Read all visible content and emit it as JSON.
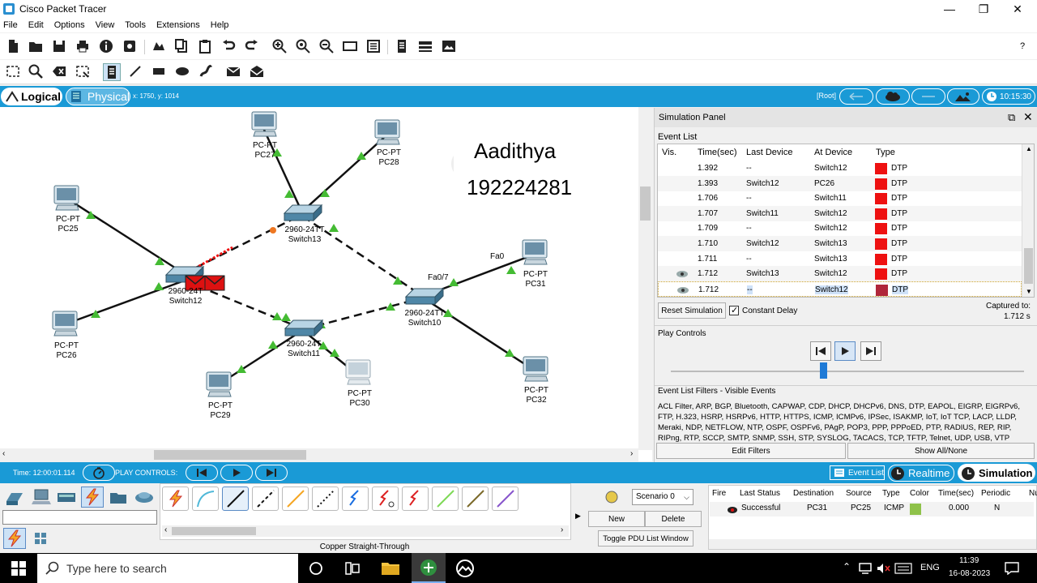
{
  "window": {
    "title": "Cisco Packet Tracer",
    "minimize": "—",
    "maximize": "❐",
    "close": "✕"
  },
  "menu": [
    "File",
    "Edit",
    "Options",
    "View",
    "Tools",
    "Extensions",
    "Help"
  ],
  "help_glyph": "?",
  "modebar": {
    "logical": "Logical",
    "physical": "Physical",
    "coords": "x: 1750, y: 1014",
    "root": "[Root]",
    "clock": "10:15:30"
  },
  "canvas": {
    "note_name": "Aadithya",
    "note_id": "192224281",
    "nodes": [
      {
        "id": "pc27",
        "type": "PC-PT",
        "name": "PC27"
      },
      {
        "id": "pc28",
        "type": "PC-PT",
        "name": "PC28"
      },
      {
        "id": "pc25",
        "type": "PC-PT",
        "name": "PC25"
      },
      {
        "id": "sw13",
        "type": "2960-24TT",
        "name": "Switch13"
      },
      {
        "id": "sw12",
        "type": "2960-24T",
        "name": "Switch12"
      },
      {
        "id": "pc31",
        "type": "PC-PT",
        "name": "PC31"
      },
      {
        "id": "sw10",
        "type": "2960-24TT",
        "name": "Switch10"
      },
      {
        "id": "pc26",
        "type": "PC-PT",
        "name": "PC26"
      },
      {
        "id": "sw11",
        "type": "2960-24T",
        "name": "Switch11"
      },
      {
        "id": "pc30",
        "type": "PC-PT",
        "name": "PC30"
      },
      {
        "id": "pc29",
        "type": "PC-PT",
        "name": "PC29"
      },
      {
        "id": "pc32",
        "type": "PC-PT",
        "name": "PC32"
      }
    ],
    "port_labels": {
      "fa0": "Fa0",
      "fa07": "Fa0/7"
    }
  },
  "sim_panel": {
    "title": "Simulation Panel",
    "event_list_label": "Event List",
    "columns": [
      "Vis.",
      "Time(sec)",
      "Last Device",
      "At Device",
      "Type"
    ],
    "events": [
      {
        "time": "1.392",
        "last": "--",
        "at": "Switch12",
        "type": "DTP",
        "eye": false
      },
      {
        "time": "1.393",
        "last": "Switch12",
        "at": "PC26",
        "type": "DTP",
        "eye": false
      },
      {
        "time": "1.706",
        "last": "--",
        "at": "Switch11",
        "type": "DTP",
        "eye": false
      },
      {
        "time": "1.707",
        "last": "Switch11",
        "at": "Switch12",
        "type": "DTP",
        "eye": false
      },
      {
        "time": "1.709",
        "last": "--",
        "at": "Switch12",
        "type": "DTP",
        "eye": false
      },
      {
        "time": "1.710",
        "last": "Switch12",
        "at": "Switch13",
        "type": "DTP",
        "eye": false
      },
      {
        "time": "1.711",
        "last": "--",
        "at": "Switch13",
        "type": "DTP",
        "eye": false
      },
      {
        "time": "1.712",
        "last": "Switch13",
        "at": "Switch12",
        "type": "DTP",
        "eye": true
      },
      {
        "time": "1.712",
        "last": "--",
        "at": "Switch12",
        "type": "DTP",
        "eye": true
      }
    ],
    "reset_label": "Reset Simulation",
    "constant_delay_label": "Constant Delay",
    "captured_label": "Captured to:",
    "captured_value": "1.712 s",
    "play_controls_label": "Play Controls",
    "filters_title": "Event List Filters - Visible Events",
    "filters_text": "ACL Filter, ARP, BGP, Bluetooth, CAPWAP, CDP, DHCP, DHCPv6, DNS, DTP, EAPOL, EIGRP, EIGRPv6, FTP, H.323, HSRP, HSRPv6, HTTP, HTTPS, ICMP, ICMPv6, IPSec, ISAKMP, IoT, IoT TCP, LACP, LLDP, Meraki, NDP, NETFLOW, NTP, OSPF, OSPFv6, PAgP, POP3, PPP, PPPoED, PTP, RADIUS, REP, RIP, RIPng, RTP, SCCP, SMTP, SNMP, SSH, STP, SYSLOG, TACACS, TCP, TFTP, Telnet, UDP, USB, VTP",
    "edit_filters": "Edit Filters",
    "show_all": "Show All/None"
  },
  "bottombar": {
    "time": "Time: 12:00:01.114",
    "play_controls": "PLAY CONTROLS:",
    "event_list": "Event List",
    "realtime": "Realtime",
    "simulation": "Simulation"
  },
  "devices": {
    "cable_label": "Copper Straight-Through"
  },
  "pdu": {
    "scenario": "Scenario 0",
    "new": "New",
    "delete": "Delete",
    "toggle": "Toggle PDU List Window",
    "columns": [
      "Fire",
      "Last Status",
      "Destination",
      "Source",
      "Type",
      "Color",
      "Time(sec)",
      "Periodic",
      "Nu"
    ],
    "row": {
      "status": "Successful",
      "destination": "PC31",
      "source": "PC25",
      "type": "ICMP",
      "color": "#8fc24a",
      "time": "0.000",
      "periodic": "N"
    }
  },
  "taskbar": {
    "search_placeholder": "Type here to search",
    "lang": "ENG",
    "time": "11:39",
    "date": "16-08-2023"
  },
  "colors": {
    "accent": "#1a9ad6",
    "event_dtp": "#ee1111",
    "link_ok": "#44bb33",
    "link_orange": "#ee7722"
  }
}
